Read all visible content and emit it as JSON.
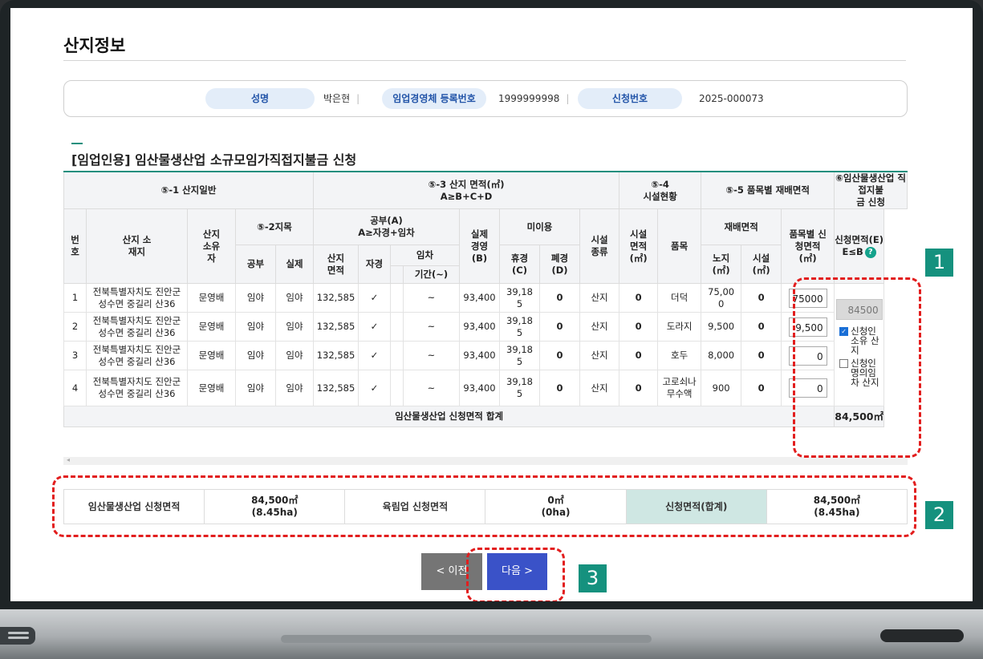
{
  "page_title": "산지정보",
  "info": {
    "name_label": "성명",
    "name_value": "박은현",
    "reg_label": "임업경영체 등록번호",
    "reg_value": "1999999998",
    "app_label": "신청번호",
    "app_value": "2025-000073"
  },
  "section_title": "[임업인용] 임산물생산업 소규모임가직접지불금 신청",
  "table": {
    "h_general": "⑤-1 산지일반",
    "h_area": "⑤-3 산지 면적(㎡)",
    "h_area_sub": "A≥B+C+D",
    "h_facility": "⑤-4",
    "h_facility_sub": "시설현황",
    "h_crop": "⑤-5 품목별 재배면적",
    "h_apply": "⑥임산물생산업 직접지불",
    "h_apply_sub": "금 신청",
    "c_no": "번호",
    "c_location": "산지 소재지",
    "c_owner": "산지 소유자",
    "c_jimok": "⑤-2지목",
    "c_public": "공부",
    "c_actual": "실제",
    "c_publicA": "공부(A)",
    "c_publicA_sub": "A≥자경+임차",
    "c_land_area": "산지 면적",
    "c_self": "자경",
    "c_lease": "임차",
    "c_period": "기간(~)",
    "c_realB": "실제 경영 (B)",
    "c_unused": "미이용",
    "c_fallowC": "휴경 (C)",
    "c_closedD": "폐경 (D)",
    "c_fac_type": "시설 종류",
    "c_fac_area": "시설 면적 (㎡)",
    "c_item": "품목",
    "c_cult_area": "재배면적",
    "c_open": "노지 (㎡)",
    "c_fac": "시설 (㎡)",
    "c_item_apply": "품목별 신청면적 (㎡)",
    "c_applyE": "신청면적(E)",
    "c_applyE_sub": "E≤B",
    "rows": [
      {
        "no": "1",
        "loc1": "전북특별자치도 진안군",
        "loc2": "성수면 중길리 산36",
        "owner": "문영배",
        "public": "임야",
        "actual": "임야",
        "area": "132,585",
        "self": "✓",
        "lease": "",
        "period": "~",
        "real": "93,400",
        "fallow1": "39,18",
        "fallow2": "5",
        "closed": "0",
        "ftype": "산지",
        "farea": "0",
        "item": "더덕",
        "open1": "75,00",
        "open2": "0",
        "fac": "0",
        "input": "75000"
      },
      {
        "no": "2",
        "loc1": "전북특별자치도 진안군",
        "loc2": "성수면 중길리 산36",
        "owner": "문영배",
        "public": "임야",
        "actual": "임야",
        "area": "132,585",
        "self": "✓",
        "lease": "",
        "period": "~",
        "real": "93,400",
        "fallow1": "39,18",
        "fallow2": "5",
        "closed": "0",
        "ftype": "산지",
        "farea": "0",
        "item": "도라지",
        "open1": "9,500",
        "open2": "",
        "fac": "0",
        "input": "9,500"
      },
      {
        "no": "3",
        "loc1": "전북특별자치도 진안군",
        "loc2": "성수면 중길리 산36",
        "owner": "문영배",
        "public": "임야",
        "actual": "임야",
        "area": "132,585",
        "self": "✓",
        "lease": "",
        "period": "~",
        "real": "93,400",
        "fallow1": "39,18",
        "fallow2": "5",
        "closed": "0",
        "ftype": "산지",
        "farea": "0",
        "item": "호두",
        "open1": "8,000",
        "open2": "",
        "fac": "0",
        "input": "0"
      },
      {
        "no": "4",
        "loc1": "전북특별자치도 진안군",
        "loc2": "성수면 중길리 산36",
        "owner": "문영배",
        "public": "임야",
        "actual": "임야",
        "area": "132,585",
        "self": "✓",
        "lease": "",
        "period": "~",
        "real": "93,400",
        "fallow1": "39,18",
        "fallow2": "5",
        "closed": "0",
        "ftype": "산지",
        "farea": "0",
        "item": "고로쇠나 무수액",
        "open1": "900",
        "open2": "",
        "fac": "0",
        "input": "0"
      }
    ],
    "apply_value": "84500",
    "cb1_label": "신청인 소유 산지",
    "cb1_checked": true,
    "cb2_label": "신청인 명의임차 산지",
    "cb2_checked": false,
    "total_label": "임산물생산업 신청면적 합계",
    "total_value": "84,500㎡"
  },
  "summary": {
    "l1": "임산물생산업 신청면적",
    "v1a": "84,500㎡",
    "v1b": "(8.45ha)",
    "l2": "육림업 신청면적",
    "v2a": "0㎡",
    "v2b": "(0ha)",
    "l3": "신청면적(합계)",
    "v3a": "84,500㎡",
    "v3b": "(8.45ha)"
  },
  "buttons": {
    "prev": "<  이전",
    "next": "다음  >"
  },
  "badges": [
    "1",
    "2",
    "3"
  ],
  "colors": {
    "accent": "#1b8f7e",
    "highlight": "#e21e1e",
    "next_button": "#3a52c8"
  }
}
